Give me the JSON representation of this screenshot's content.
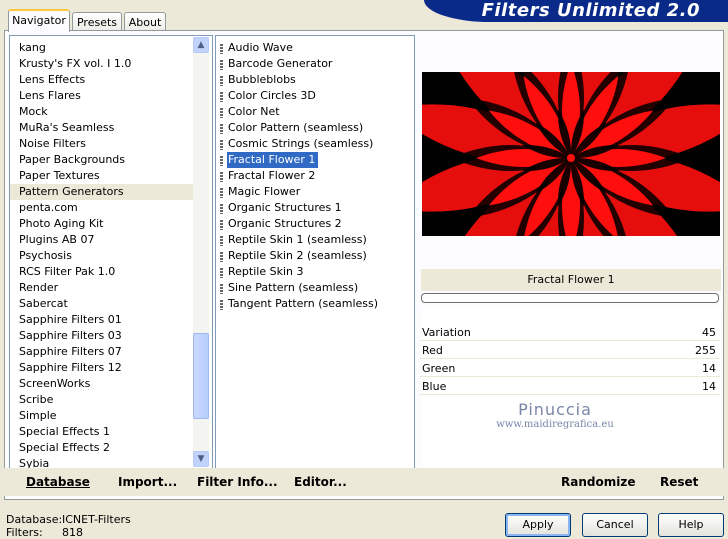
{
  "app": {
    "banner_title": "Filters Unlimited 2.0"
  },
  "tabs": [
    {
      "label": "Navigator"
    },
    {
      "label": "Presets"
    },
    {
      "label": "About"
    }
  ],
  "categories": {
    "items": [
      "kang",
      "Krusty's FX vol. I 1.0",
      "Lens Effects",
      "Lens Flares",
      "Mock",
      "MuRa's Seamless",
      "Noise Filters",
      "Paper Backgrounds",
      "Paper Textures",
      "Pattern Generators",
      "penta.com",
      "Photo Aging Kit",
      "Plugins AB 07",
      "Psychosis",
      "RCS Filter Pak 1.0",
      "Render",
      "Sabercat",
      "Sapphire Filters 01",
      "Sapphire Filters 03",
      "Sapphire Filters 07",
      "Sapphire Filters 12",
      "ScreenWorks",
      "Scribe",
      "Simple",
      "Special Effects 1",
      "Special Effects 2",
      "Sybia"
    ],
    "highlighted": "Pattern Generators"
  },
  "filters": {
    "items": [
      "Audio Wave",
      "Barcode Generator",
      "Bubbleblobs",
      "Color Circles 3D",
      "Color Net",
      "Color Pattern (seamless)",
      "Cosmic Strings (seamless)",
      "Fractal Flower 1",
      "Fractal Flower 2",
      "Magic Flower",
      "Organic Structures 1",
      "Organic Structures 2",
      "Reptile Skin 1 (seamless)",
      "Reptile Skin 2 (seamless)",
      "Reptile Skin 3",
      "Sine Pattern (seamless)",
      "Tangent Pattern (seamless)"
    ],
    "selected": "Fractal Flower 1"
  },
  "preview": {
    "filter_name": "Fractal Flower 1",
    "progress": 0
  },
  "parameters": [
    {
      "label": "Variation",
      "value": "45"
    },
    {
      "label": "Red",
      "value": "255"
    },
    {
      "label": "Green",
      "value": "14"
    },
    {
      "label": "Blue",
      "value": "14"
    }
  ],
  "watermark": {
    "line1": "Pinuccia",
    "line2": "www.maidiregrafica.eu"
  },
  "toolbar": {
    "database": "Database",
    "import": "Import...",
    "filter_info": "Filter Info...",
    "editor": "Editor...",
    "randomize": "Randomize",
    "reset": "Reset"
  },
  "status": {
    "database_label": "Database:",
    "database_value": "ICNET-Filters",
    "filters_label": "Filters:",
    "filters_value": "818"
  },
  "dialog": {
    "apply": "Apply",
    "cancel": "Cancel",
    "help": "Help"
  },
  "colors": {
    "banner": "#0a2a8a",
    "selection": "#316ac5",
    "flower_red": "#ff0e0e"
  }
}
